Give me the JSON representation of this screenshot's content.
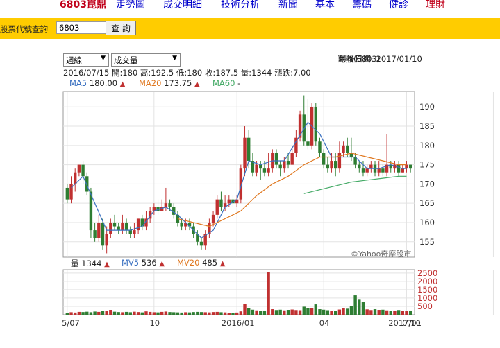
{
  "nav": {
    "title": "6803崑鼎",
    "links": [
      "走勢圖",
      "成交明細",
      "技術分析",
      "新聞",
      "基本",
      "籌碼",
      "健診"
    ],
    "last": "理財"
  },
  "search": {
    "label": "股票代號查詢",
    "value": "6803",
    "button": "查 詢"
  },
  "controls": {
    "period": "週線",
    "indicator": "成交量"
  },
  "header": {
    "stock": "崑鼎(6803)",
    "last_date_label": "最後日期: 2017/01/10",
    "ohlc": "2016/07/15 開:180 高:192.5 低:180 收:187.5 量:1344 漲跌:7.00"
  },
  "ma_legend": [
    {
      "label": "MA5",
      "value": "180.00",
      "dir": "▲",
      "color": "#3a70c0"
    },
    {
      "label": "MA20",
      "value": "173.75",
      "dir": "▲",
      "color": "#e07820"
    },
    {
      "label": "MA60",
      "value": "-",
      "dir": "",
      "color": "#44aa66"
    }
  ],
  "vol_legend": [
    {
      "label": "量",
      "value": "1344",
      "dir": "▲",
      "color": "#222222"
    },
    {
      "label": "MV5",
      "value": "536",
      "dir": "▲",
      "color": "#3a70c0"
    },
    {
      "label": "MV20",
      "value": "485",
      "dir": "▲",
      "color": "#e07820"
    }
  ],
  "watermark": "©Yahoo奇摩股市",
  "colors": {
    "up": "#c03030",
    "down": "#2e7d32",
    "ma5": "#3a70c0",
    "ma20": "#e07820",
    "ma60": "#44aa66",
    "up_arrow": "#c03030"
  },
  "chart_data": {
    "type": "candlestick",
    "price_axis": {
      "ylim": [
        151,
        194
      ],
      "ticks": [
        155,
        160,
        165,
        170,
        175,
        180,
        185,
        190
      ]
    },
    "volume_axis": {
      "ylim": [
        0,
        2700
      ],
      "ticks": [
        500,
        1000,
        1500,
        2000,
        2500
      ]
    },
    "x_labels": [
      {
        "label": "5/07",
        "index": 0
      },
      {
        "label": "10",
        "index": 22
      },
      {
        "label": "2016/01",
        "index": 43
      },
      {
        "label": "04",
        "index": 65
      },
      {
        "label": "07",
        "index": 86
      },
      {
        "label": "10",
        "index": 108
      },
      {
        "label": "2017/01",
        "index": 129
      }
    ],
    "candles": [
      [
        169,
        166,
        170,
        165
      ],
      [
        166,
        170,
        172,
        165
      ],
      [
        170,
        173,
        174,
        168
      ],
      [
        173,
        175,
        175,
        172
      ],
      [
        175,
        172,
        176,
        170
      ],
      [
        172,
        168,
        173,
        167
      ],
      [
        168,
        158,
        169,
        156
      ],
      [
        158,
        156,
        160,
        155
      ],
      [
        156,
        160,
        162,
        155
      ],
      [
        160,
        154,
        161,
        153
      ],
      [
        154,
        157,
        159,
        152
      ],
      [
        157,
        160,
        161,
        156
      ],
      [
        160,
        159,
        162,
        158
      ],
      [
        159,
        158,
        160,
        157
      ],
      [
        158,
        160,
        162,
        157
      ],
      [
        160,
        158,
        161,
        157
      ],
      [
        158,
        157,
        159,
        156
      ],
      [
        157,
        158,
        160,
        156
      ],
      [
        158,
        161,
        161,
        157
      ],
      [
        161,
        159,
        162,
        158
      ],
      [
        159,
        161,
        163,
        158
      ],
      [
        161,
        163,
        164,
        160
      ],
      [
        163,
        164,
        165,
        162
      ],
      [
        164,
        163,
        166,
        162
      ],
      [
        163,
        164,
        166,
        163
      ],
      [
        164,
        165,
        169,
        163
      ],
      [
        165,
        164,
        166,
        163
      ],
      [
        164,
        162,
        165,
        161
      ],
      [
        162,
        160,
        163,
        159
      ],
      [
        160,
        159,
        161,
        158
      ],
      [
        159,
        160,
        161,
        158
      ],
      [
        160,
        159,
        161,
        158
      ],
      [
        159,
        157,
        160,
        156
      ],
      [
        157,
        155,
        158,
        154
      ],
      [
        155,
        154,
        156,
        153
      ],
      [
        154,
        157,
        158,
        153
      ],
      [
        157,
        160,
        161,
        156
      ],
      [
        160,
        162,
        163,
        159
      ],
      [
        162,
        166,
        167,
        161
      ],
      [
        166,
        164,
        168,
        163
      ],
      [
        164,
        165,
        167,
        163
      ],
      [
        165,
        166,
        167,
        164
      ],
      [
        166,
        165,
        167,
        164
      ],
      [
        165,
        166,
        167,
        164
      ],
      [
        166,
        174,
        175,
        165
      ],
      [
        174,
        182,
        185,
        172
      ],
      [
        182,
        176,
        184,
        174
      ],
      [
        176,
        173,
        178,
        172
      ],
      [
        173,
        175,
        176,
        172
      ],
      [
        175,
        174,
        176,
        171
      ],
      [
        174,
        173,
        176,
        172
      ],
      [
        173,
        174,
        178,
        172
      ],
      [
        174,
        178,
        179,
        173
      ],
      [
        178,
        175,
        179,
        174
      ],
      [
        175,
        174,
        176,
        172
      ],
      [
        174,
        176,
        177,
        173
      ],
      [
        176,
        175,
        178,
        174
      ],
      [
        175,
        178,
        180,
        175
      ],
      [
        178,
        182,
        184,
        177
      ],
      [
        182,
        188,
        189,
        181
      ],
      [
        188,
        181,
        193,
        180
      ],
      [
        181,
        180,
        192,
        179
      ],
      [
        180,
        190,
        191,
        179
      ],
      [
        190,
        181,
        191,
        180
      ],
      [
        181,
        178,
        182,
        177
      ],
      [
        178,
        175,
        179,
        174
      ],
      [
        175,
        174,
        177,
        173
      ],
      [
        174,
        176,
        178,
        173
      ],
      [
        176,
        174,
        178,
        172
      ],
      [
        174,
        178,
        181,
        173
      ],
      [
        178,
        180,
        181,
        177
      ],
      [
        180,
        178,
        182,
        177
      ],
      [
        178,
        177,
        182,
        176
      ],
      [
        177,
        175,
        178,
        174
      ],
      [
        175,
        174,
        176,
        173
      ],
      [
        174,
        173,
        176,
        172
      ],
      [
        173,
        174,
        175,
        172
      ],
      [
        174,
        175,
        176,
        173
      ],
      [
        175,
        173,
        176,
        172
      ],
      [
        173,
        174,
        176,
        172
      ],
      [
        174,
        173,
        175,
        172
      ],
      [
        173,
        175,
        183,
        172
      ],
      [
        175,
        174,
        176,
        173
      ],
      [
        174,
        175,
        176,
        173
      ],
      [
        175,
        173,
        176,
        172
      ],
      [
        173,
        174,
        175,
        173
      ],
      [
        174,
        175,
        176,
        173
      ],
      [
        175,
        174,
        175,
        173
      ]
    ],
    "volume": [
      100,
      150,
      130,
      170,
      160,
      180,
      150,
      190,
      170,
      210,
      220,
      290,
      180,
      160,
      150,
      170,
      150,
      180,
      160,
      140,
      200,
      170,
      150,
      140,
      170,
      190,
      160,
      150,
      140,
      130,
      150,
      140,
      160,
      170,
      160,
      150,
      140,
      160,
      170,
      150,
      140,
      120,
      120,
      130,
      200,
      660,
      380,
      300,
      260,
      240,
      250,
      2550,
      330,
      280,
      300,
      260,
      290,
      310,
      280,
      270,
      480,
      410,
      380,
      620,
      330,
      300,
      270,
      230,
      220,
      310,
      400,
      360,
      500,
      1160,
      900,
      760,
      320,
      280,
      330,
      290,
      300,
      260,
      230,
      250,
      280,
      240,
      220,
      250,
      230,
      210,
      240,
      220,
      260,
      270
    ],
    "ma5_sparse": [
      [
        1,
        169
      ],
      [
        4,
        172
      ],
      [
        7,
        165
      ],
      [
        10,
        158
      ],
      [
        13,
        158
      ],
      [
        16,
        158
      ],
      [
        19,
        159
      ],
      [
        22,
        163
      ],
      [
        25,
        164
      ],
      [
        28,
        162
      ],
      [
        31,
        159
      ],
      [
        34,
        156
      ],
      [
        37,
        158
      ],
      [
        40,
        164
      ],
      [
        43,
        166
      ],
      [
        46,
        176
      ],
      [
        49,
        175
      ],
      [
        52,
        176
      ],
      [
        55,
        176
      ],
      [
        58,
        181
      ],
      [
        61,
        186
      ],
      [
        64,
        183
      ],
      [
        67,
        177
      ],
      [
        70,
        177
      ],
      [
        73,
        177
      ],
      [
        76,
        174
      ],
      [
        79,
        174
      ],
      [
        82,
        175
      ],
      [
        85,
        174
      ],
      [
        86,
        174
      ]
    ],
    "ma20_sparse": [
      [
        28,
        161
      ],
      [
        32,
        160
      ],
      [
        36,
        159
      ],
      [
        40,
        161
      ],
      [
        44,
        163
      ],
      [
        48,
        167
      ],
      [
        52,
        170
      ],
      [
        56,
        172
      ],
      [
        60,
        175
      ],
      [
        64,
        177
      ],
      [
        68,
        177
      ],
      [
        72,
        178
      ],
      [
        76,
        177
      ],
      [
        80,
        176
      ],
      [
        84,
        175
      ],
      [
        86,
        175
      ]
    ],
    "ma60_sparse": [
      [
        60,
        167.5
      ],
      [
        64,
        168.5
      ],
      [
        68,
        169.5
      ],
      [
        72,
        170.5
      ],
      [
        76,
        171
      ],
      [
        80,
        171.5
      ],
      [
        84,
        172
      ],
      [
        86,
        172
      ]
    ]
  }
}
